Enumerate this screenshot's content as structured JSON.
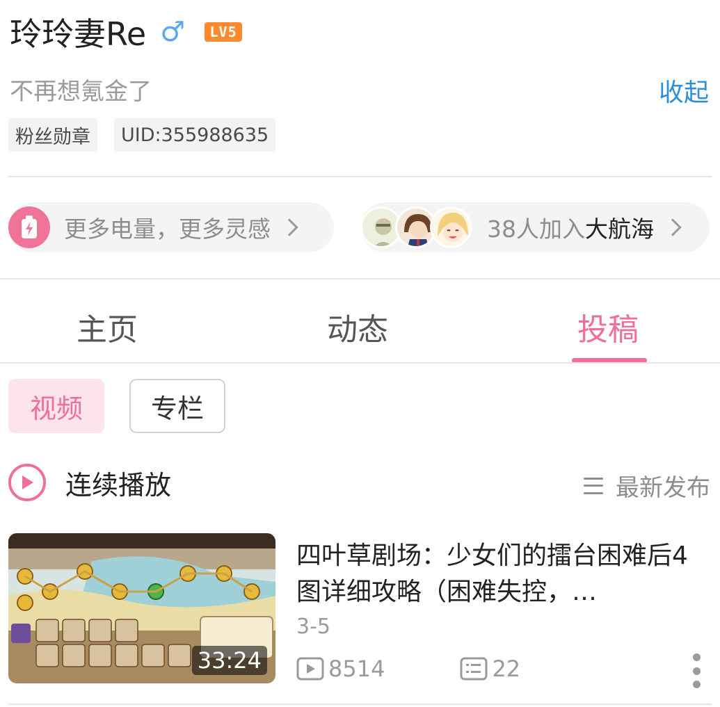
{
  "profile": {
    "username": "玲玲妻Re",
    "gender_symbol": "♂",
    "level": "LV5",
    "signature": "不再想氪金了",
    "collapse_label": "收起",
    "tags": [
      "粉丝勋章",
      "UID:355988635"
    ]
  },
  "promo": {
    "battery_text": "更多电量，更多灵感",
    "fleet_count_text": "38人加入",
    "fleet_name": "大航海"
  },
  "tabs": [
    {
      "label": "主页",
      "active": false
    },
    {
      "label": "动态",
      "active": false
    },
    {
      "label": "投稿",
      "active": true
    }
  ],
  "subtabs": [
    {
      "label": "视频",
      "active": true
    },
    {
      "label": "专栏",
      "active": false
    }
  ],
  "playbar": {
    "continuous_label": "连续播放",
    "sort_label": "最新发布"
  },
  "video": {
    "title": "四叶草剧场：少女们的擂台困难后4图详细攻略（困难失控，…",
    "date": "3-5",
    "duration": "33:24",
    "views": "8514",
    "comments": "22"
  },
  "colors": {
    "accent_pink": "#ef6f98",
    "link_blue": "#2d8fd6",
    "level_orange": "#ff8a2e"
  }
}
